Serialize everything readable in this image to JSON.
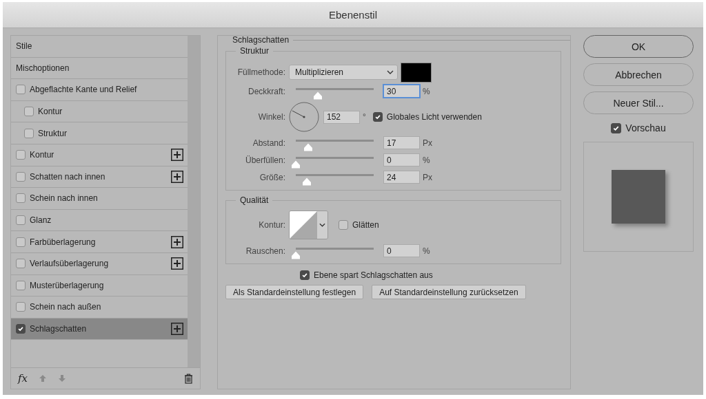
{
  "window": {
    "title": "Ebenenstil"
  },
  "sidebar": {
    "items": [
      {
        "kind": "header",
        "label": "Stile",
        "selected": false
      },
      {
        "kind": "header",
        "label": "Mischoptionen",
        "selected": false
      },
      {
        "kind": "checkbox",
        "label": "Abgeflachte Kante und Relief",
        "checked": false,
        "selected": false,
        "add": false,
        "children": [
          {
            "kind": "checkbox",
            "label": "Kontur",
            "checked": false,
            "selected": false,
            "add": false
          },
          {
            "kind": "checkbox",
            "label": "Struktur",
            "checked": false,
            "selected": false,
            "add": false
          }
        ]
      },
      {
        "kind": "checkbox",
        "label": "Kontur",
        "checked": false,
        "selected": false,
        "add": true
      },
      {
        "kind": "checkbox",
        "label": "Schatten nach innen",
        "checked": false,
        "selected": false,
        "add": true
      },
      {
        "kind": "checkbox",
        "label": "Schein nach innen",
        "checked": false,
        "selected": false,
        "add": false
      },
      {
        "kind": "checkbox",
        "label": "Glanz",
        "checked": false,
        "selected": false,
        "add": false
      },
      {
        "kind": "checkbox",
        "label": "Farbüberlagerung",
        "checked": false,
        "selected": false,
        "add": true
      },
      {
        "kind": "checkbox",
        "label": "Verlaufsüberlagerung",
        "checked": false,
        "selected": false,
        "add": true
      },
      {
        "kind": "checkbox",
        "label": "Musterüberlagerung",
        "checked": false,
        "selected": false,
        "add": false
      },
      {
        "kind": "checkbox",
        "label": "Schein nach außen",
        "checked": false,
        "selected": false,
        "add": false
      },
      {
        "kind": "checkbox",
        "label": "Schlagschatten",
        "checked": true,
        "selected": true,
        "add": true
      }
    ],
    "toolbar": {
      "effects_button": "fx"
    }
  },
  "panel": {
    "title": "Schlagschatten",
    "structure": {
      "title": "Struktur",
      "blend_mode": {
        "label": "Füllmethode:",
        "value": "Multiplizieren"
      },
      "rows": [
        {
          "kind": "slider",
          "label": "Deckkraft:",
          "level": 0.28,
          "value": "30",
          "unit": "%",
          "focused": true
        },
        {
          "kind": "angle",
          "label": "Winkel:",
          "value": "152",
          "unit": "°",
          "global_light": {
            "label": "Globales Licht verwenden",
            "checked": true
          }
        },
        {
          "kind": "slider",
          "label": "Abstand:",
          "level": 0.16,
          "value": "17",
          "unit": "Px",
          "focused": false
        },
        {
          "kind": "slider",
          "label": "Überfüllen:",
          "level": 0,
          "value": "0",
          "unit": "%",
          "focused": false
        },
        {
          "kind": "slider",
          "label": "Größe:",
          "level": 0.14,
          "value": "24",
          "unit": "Px",
          "focused": false
        }
      ]
    },
    "quality": {
      "title": "Qualität",
      "contour": {
        "label": "Kontur:"
      },
      "anti_alias": {
        "label": "Glätten",
        "checked": false
      },
      "noise": {
        "label": "Rauschen:",
        "level": 0,
        "value": "0",
        "unit": "%",
        "focused": false
      }
    },
    "knockout": {
      "label": "Ebene spart Schlagschatten aus",
      "checked": true
    },
    "buttons": [
      "Als Standardeinstellung festlegen",
      "Auf Standardeinstellung zurücksetzen"
    ]
  },
  "actions": [
    {
      "label": "OK",
      "default": true
    },
    {
      "label": "Abbrechen",
      "default": false
    },
    {
      "label": "Neuer Stil...",
      "default": false
    }
  ],
  "preview": {
    "label": "Vorschau",
    "checked": true
  }
}
